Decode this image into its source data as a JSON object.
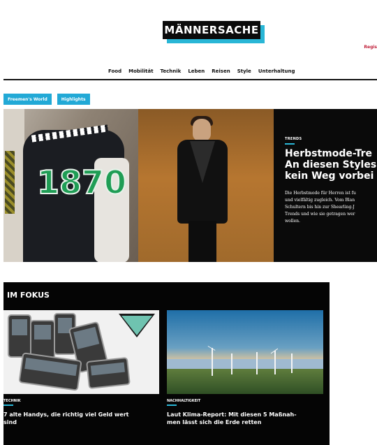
{
  "header": {
    "logo": "MÄNNERSACHE",
    "register_link": "Regis",
    "nav": [
      "Food",
      "Mobilität",
      "Technik",
      "Leben",
      "Reisen",
      "Style",
      "Unterhaltung"
    ]
  },
  "tags": [
    "Freemen's World",
    "Highlights"
  ],
  "hero": {
    "kicker": "TRENDS",
    "title": "Herbstmode-Tre\nAn diesen Styles\nkein Weg vorbei",
    "teaser": "Die Herbstmode für Herren ist fu\nund vielfältig zugleich. Vom Blan\nSchultern bis hin zur Shearling-J\nTrends und wie sie getragen wer\nwollen.",
    "jacket_number": "1870"
  },
  "fokus": {
    "title": "IM FOKUS",
    "cards": [
      {
        "kicker": "TECHNIK",
        "title": "7 alte Handys, die richtig viel Geld wert\nsind"
      },
      {
        "kicker": "NACHHALTIGKEIT",
        "title": "Laut Klima-Report: Mit diesen 5 Maßnah-\nmen lässt sich die Erde retten"
      }
    ]
  },
  "colors": {
    "accent": "#29b6d6",
    "tag": "#22a9d6",
    "register": "#c0203a"
  }
}
